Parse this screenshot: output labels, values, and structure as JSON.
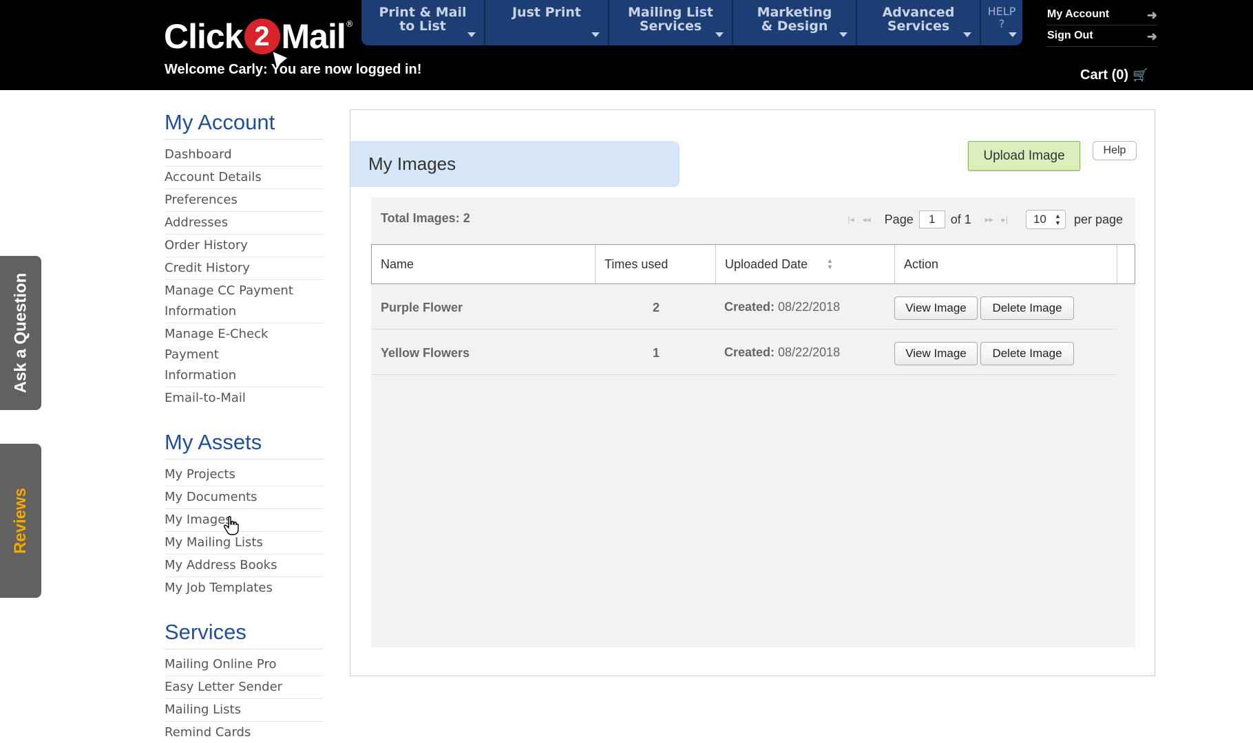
{
  "header": {
    "logo": {
      "part1": "Click",
      "part2": "2",
      "part3": "Mail",
      "tm": "®"
    },
    "welcome": "Welcome Carly: You are now logged in!",
    "nav": [
      {
        "line1": "Print & Mail",
        "line2": "to List"
      },
      {
        "line1": "Just Print",
        "line2": ""
      },
      {
        "line1": "Mailing List",
        "line2": "Services"
      },
      {
        "line1": "Marketing",
        "line2": "& Design"
      },
      {
        "line1": "Advanced",
        "line2": "Services"
      }
    ],
    "help": {
      "line1": "HELP",
      "line2": "?"
    },
    "my_account": "My Account",
    "sign_out": "Sign Out",
    "cart": "Cart (0)",
    "arrow_glyph": "➜",
    "cart_glyph": "🛒"
  },
  "side_tabs": {
    "question": "Ask a Question",
    "reviews": "Reviews"
  },
  "sidebar": {
    "account_title": "My Account",
    "account_items": [
      "Dashboard",
      "Account Details",
      "Preferences",
      "Addresses",
      "Order History",
      "Credit History"
    ],
    "account_multi": [
      {
        "line1": "Manage CC Payment",
        "line2": "Information"
      },
      {
        "line1": "Manage E-Check Payment",
        "line2": "Information"
      }
    ],
    "email_to_mail": "Email-to-Mail",
    "assets_title": "My Assets",
    "assets_items": [
      "My Projects",
      "My Documents",
      "My Images",
      "My Mailing Lists",
      "My Address Books",
      "My Job Templates"
    ],
    "services_title": "Services",
    "services_items": [
      "Mailing Online Pro",
      "Easy Letter Sender",
      "Mailing Lists",
      "Remind Cards"
    ]
  },
  "main": {
    "title": "My Images",
    "upload_label": "Upload Image",
    "help_label": "Help",
    "total_label": "Total Images: 2",
    "pager": {
      "first": "|◂",
      "prev": "◂◂",
      "page_label": "Page",
      "page_value": "1",
      "of_label": "of 1",
      "next": "▸▸",
      "last": "▸|",
      "per_page_value": "10",
      "per_page_label": "per page"
    },
    "columns": [
      "Name",
      "Times used",
      "Uploaded Date",
      "Action"
    ],
    "rows": [
      {
        "name": "Purple Flower",
        "times": "2",
        "created_label": "Created:",
        "date": "08/22/2018",
        "view": "View Image",
        "delete": "Delete Image"
      },
      {
        "name": "Yellow Flowers",
        "times": "1",
        "created_label": "Created:",
        "date": "08/22/2018",
        "view": "View Image",
        "delete": "Delete Image"
      }
    ]
  },
  "colors": {
    "header_bg": "#000000",
    "nav_bg": "#1c3e74",
    "logo_red": "#d8232a",
    "section_title": "#1f4f9c",
    "title_bar_bg": "#d6e6f7",
    "upload_bg": "#dbeebb",
    "reviews_text": "#f2a900"
  }
}
